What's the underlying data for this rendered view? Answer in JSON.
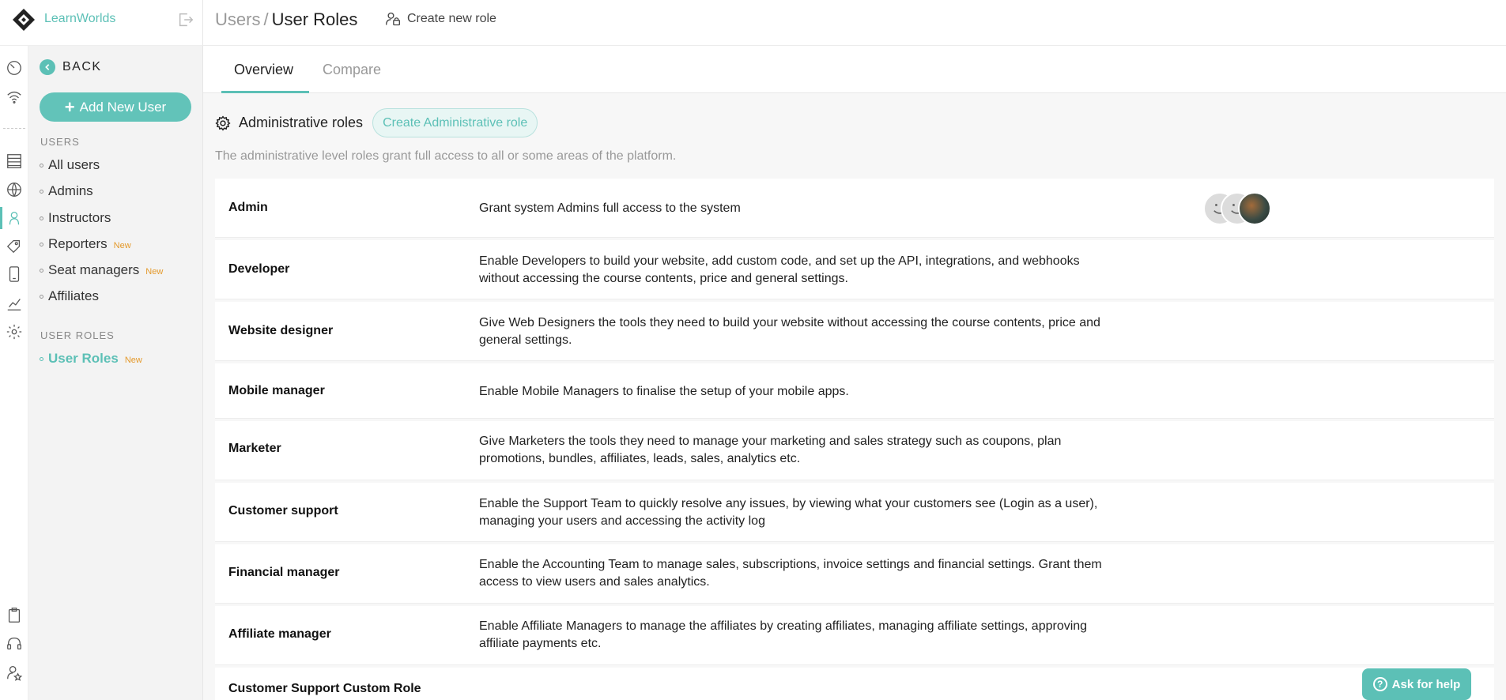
{
  "brand": {
    "name": "LearnWorlds"
  },
  "sidebar": {
    "back_label": "BACK",
    "add_user_label": "Add New User",
    "users_section_title": "USERS",
    "users_items": [
      {
        "label": "All users",
        "badge": ""
      },
      {
        "label": "Admins",
        "badge": ""
      },
      {
        "label": "Instructors",
        "badge": ""
      },
      {
        "label": "Reporters",
        "badge": "New"
      },
      {
        "label": "Seat managers",
        "badge": "New"
      },
      {
        "label": "Affiliates",
        "badge": ""
      }
    ],
    "roles_section_title": "USER ROLES",
    "roles_items": [
      {
        "label": "User Roles",
        "badge": "New",
        "active": true
      }
    ]
  },
  "header": {
    "breadcrumb_parent": "Users",
    "breadcrumb_separator": "/",
    "breadcrumb_current": "User Roles",
    "create_role_label": "Create new role"
  },
  "tabs": [
    {
      "label": "Overview",
      "active": true
    },
    {
      "label": "Compare",
      "active": false
    }
  ],
  "admin_section": {
    "title": "Administrative roles",
    "create_button_label": "Create Administrative role",
    "description": "The administrative level roles grant full access to all or some areas of the platform."
  },
  "roles": [
    {
      "name": "Admin",
      "description": "Grant system Admins full access to the system",
      "avatars": [
        "smiley",
        "smiley",
        "photo"
      ]
    },
    {
      "name": "Developer",
      "description": "Enable Developers to build your website, add custom code, and set up the API, integrations, and webhooks without accessing the course contents, price and general settings."
    },
    {
      "name": "Website designer",
      "description": "Give Web Designers the tools they need to build your website without accessing the course contents, price and general settings."
    },
    {
      "name": "Mobile manager",
      "description": "Enable Mobile Managers to finalise the setup of your mobile apps."
    },
    {
      "name": "Marketer",
      "description": "Give Marketers the tools they need to manage your marketing and sales strategy such as coupons, plan promotions, bundles, affiliates, leads, sales, analytics etc."
    },
    {
      "name": "Customer support",
      "description": "Enable the Support Team to quickly resolve any issues, by viewing what your customers see (Login as a user), managing your users and accessing the activity log"
    },
    {
      "name": "Financial manager",
      "description": "Enable the Accounting Team to manage sales, subscriptions, invoice settings and financial settings. Grant them access to view users and sales analytics."
    },
    {
      "name": "Affiliate manager",
      "description": "Enable Affiliate Managers to manage the affiliates by creating affiliates, managing affiliate settings, approving affiliate payments etc."
    },
    {
      "name": "Customer Support Custom Role",
      "description": ""
    }
  ],
  "help_button_label": "Ask for help",
  "colors": {
    "accent": "#5cc0b6",
    "new_badge": "#e49a2c"
  }
}
